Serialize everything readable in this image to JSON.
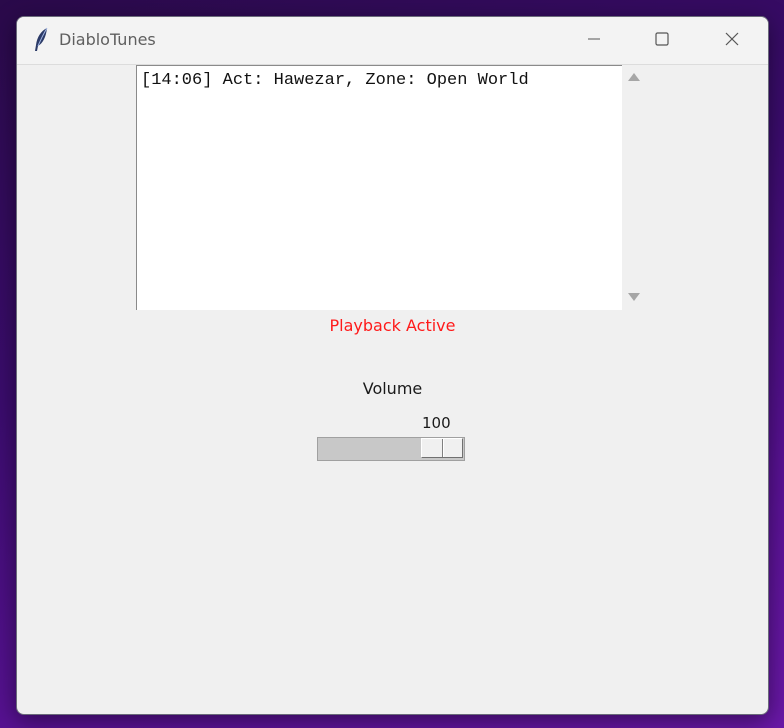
{
  "window": {
    "title": "DiabloTunes",
    "app_icon": "feather-icon"
  },
  "titlebar_controls": {
    "minimize_icon": "minimize-icon",
    "maximize_icon": "maximize-icon",
    "close_icon": "close-icon"
  },
  "log": {
    "lines": [
      "[14:06] Act: Hawezar, Zone: Open World"
    ]
  },
  "status": {
    "text": "Playback Active",
    "color": "#ff1a1a"
  },
  "volume": {
    "label": "Volume",
    "value": "100",
    "min": 0,
    "max": 100,
    "level": 100
  }
}
